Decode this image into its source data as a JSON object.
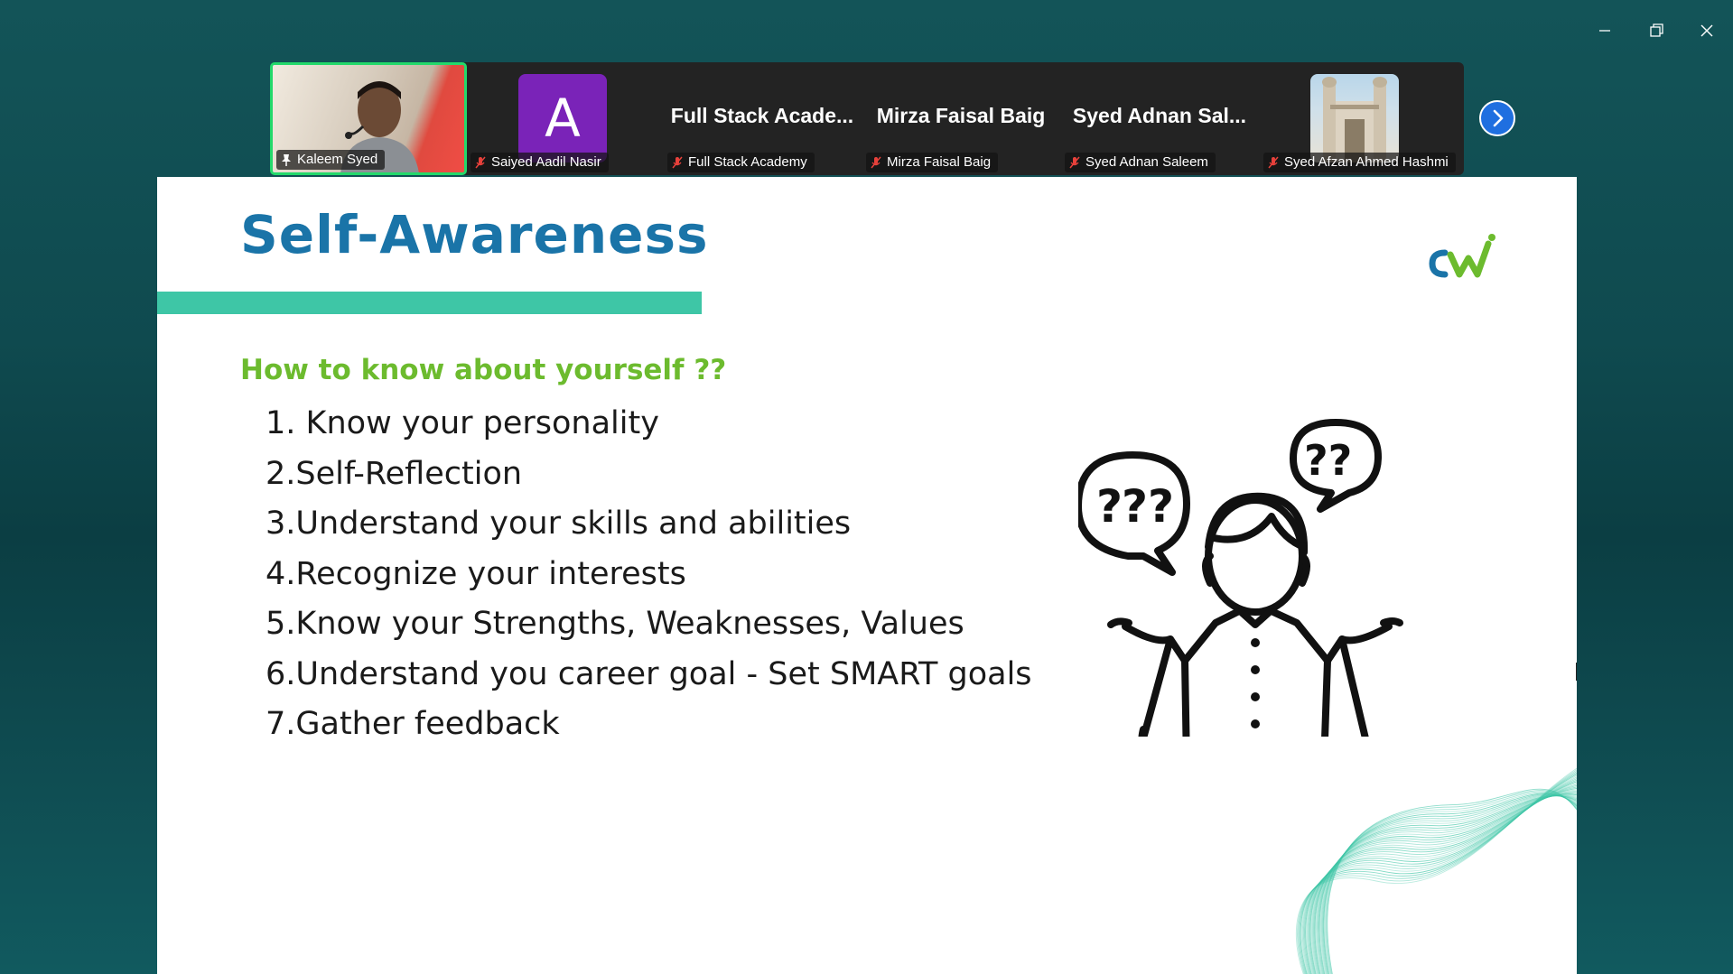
{
  "window": {
    "minimize_icon": "minimize-icon",
    "restore_icon": "restore-icon",
    "close_icon": "close-icon"
  },
  "participants": {
    "tiles": [
      {
        "name": "Kaleem Syed",
        "status_icon": "pin-icon",
        "type": "video"
      },
      {
        "name": "Saiyed Aadil Nasir",
        "status_icon": "muted-mic-icon",
        "type": "avatar",
        "avatar_letter": "A"
      },
      {
        "name": "Full Stack Academy",
        "display_name": "Full Stack Acade...",
        "status_icon": "muted-mic-icon",
        "type": "name"
      },
      {
        "name": "Mirza Faisal Baig",
        "display_name": "Mirza Faisal Baig",
        "status_icon": "muted-mic-icon",
        "type": "name"
      },
      {
        "name": "Syed Adnan Saleem",
        "display_name": "Syed Adnan Sal...",
        "status_icon": "muted-mic-icon",
        "type": "name"
      },
      {
        "name": "Syed Afzan Ahmed Hashmi",
        "status_icon": "muted-mic-icon",
        "type": "photo"
      }
    ],
    "next_icon": "chevron-right-icon"
  },
  "slide": {
    "title": "Self-Awareness",
    "subtitle": "How to know about yourself ??",
    "points": [
      "1. Know your personality",
      "2.Self-Reflection",
      "3.Understand your skills and abilities",
      "4.Recognize your interests",
      "5.Know your Strengths, Weaknesses, Values",
      "6.Understand you career goal - Set SMART goals",
      "7.Gather feedback"
    ],
    "illustration_bubble_text": "??",
    "colors": {
      "title": "#1a74a8",
      "subtitle": "#6cbb2e",
      "accent_bar": "#3ec6a6",
      "wave": "#3ec6a6"
    }
  }
}
